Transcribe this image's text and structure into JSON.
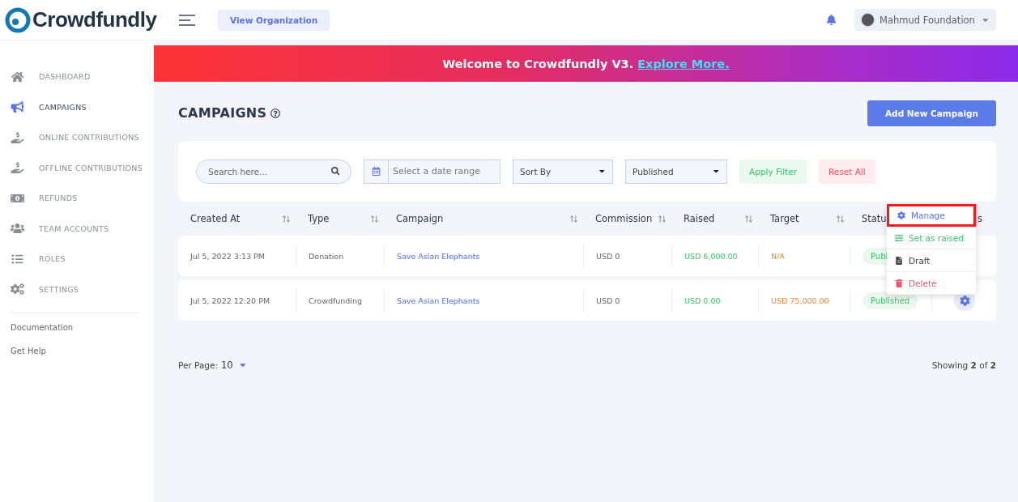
{
  "header": {
    "logo": "Crowdfundly",
    "view_button": "View Organization",
    "organization": "Mahmud Foundation"
  },
  "sidebar": {
    "items": [
      {
        "label": "DASHBOARD",
        "selected": false
      },
      {
        "label": "CAMPAIGNS",
        "selected": true
      },
      {
        "label": "ONLINE CONTRIBUTIONS",
        "selected": false
      },
      {
        "label": "OFFLINE CONTRIBUTIONS",
        "selected": false
      },
      {
        "label": "REFUNDS",
        "selected": false
      },
      {
        "label": "TEAM ACCOUNTS",
        "selected": false
      },
      {
        "label": "ROLES",
        "selected": false
      },
      {
        "label": "SETTINGS",
        "selected": false
      }
    ],
    "links": [
      "Documentation",
      "Get Help"
    ]
  },
  "banner": {
    "text": "Welcome to Crowdfundly V3.",
    "link": "Explore More."
  },
  "page": {
    "title": "CAMPAIGNS",
    "add_button": "Add New Campaign"
  },
  "filters": {
    "search_placeholder": "Search here...",
    "date_placeholder": "Select a date range",
    "sort": "Sort By",
    "status": "Published",
    "apply": "Apply Filter",
    "reset": "Reset All"
  },
  "table": {
    "columns": [
      "Created At",
      "Type",
      "Campaign",
      "Commission",
      "Raised",
      "Target",
      "Statu",
      "s"
    ],
    "rows": [
      {
        "created_at": "Jul 5, 2022 3:13 PM",
        "type": "Donation",
        "campaign": "Save Asian Elephants",
        "commission": "USD 0",
        "raised": "USD 6,000.00",
        "target": "N/A",
        "status": "Publ",
        "action_visible": false
      },
      {
        "created_at": "Jul 5, 2022 12:20 PM",
        "type": "Crowdfunding",
        "campaign": "Save Asian Elephants",
        "commission": "USD 0",
        "raised": "USD 0.00",
        "target": "USD 75,000.00",
        "status": "Published",
        "action_visible": true
      }
    ]
  },
  "action_menu": {
    "items": [
      {
        "label": "Manage",
        "kind": "manage",
        "highlighted": true
      },
      {
        "label": "Set as raised",
        "kind": "raised",
        "highlighted": false
      },
      {
        "label": "Draft",
        "kind": "draft",
        "highlighted": false
      },
      {
        "label": "Delete",
        "kind": "delete",
        "highlighted": false
      }
    ]
  },
  "footer": {
    "per_page_label": "Per Page:",
    "per_page": "10",
    "showing": "Showing **2** of **2**"
  }
}
